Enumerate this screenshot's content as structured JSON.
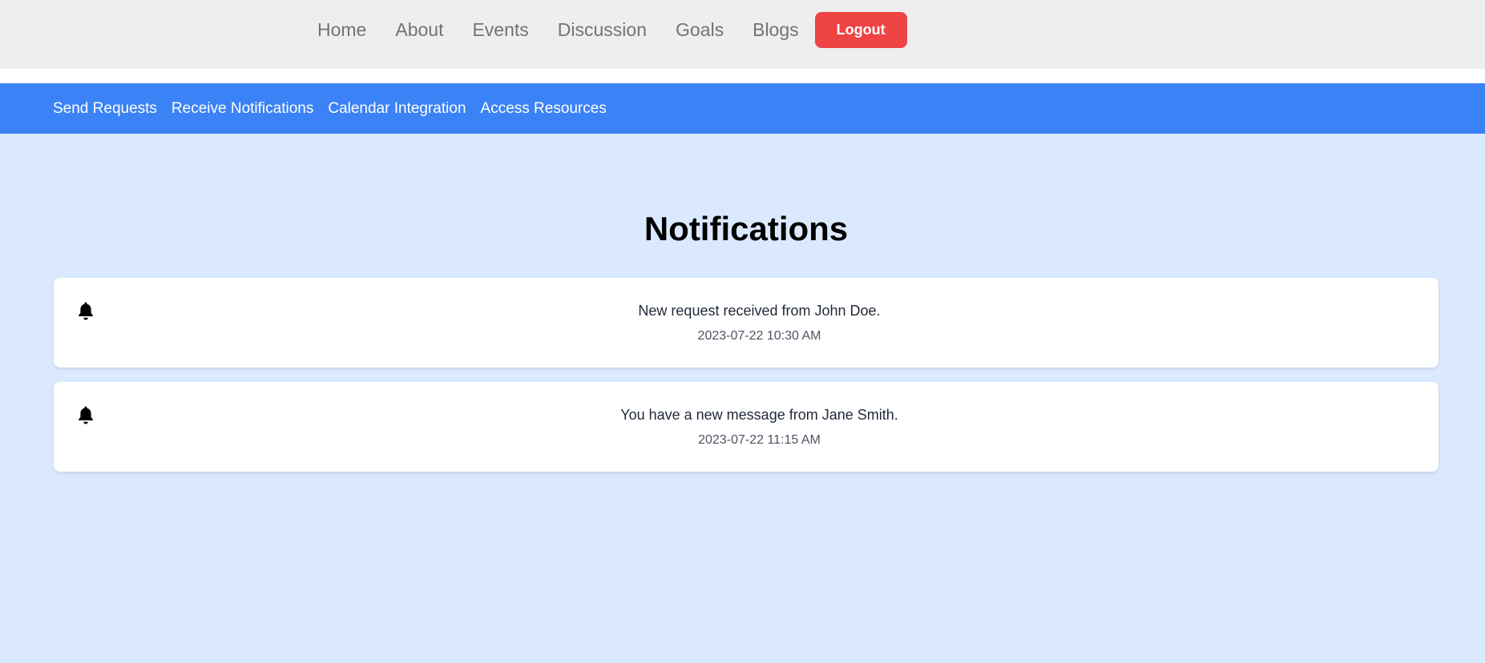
{
  "topnav": {
    "links": [
      "Home",
      "About",
      "Events",
      "Discussion",
      "Goals",
      "Blogs"
    ],
    "logout_label": "Logout"
  },
  "subnav": {
    "links": [
      "Send Requests",
      "Receive Notifications",
      "Calendar Integration",
      "Access Resources"
    ]
  },
  "main": {
    "title": "Notifications",
    "notifications": [
      {
        "message": "New request received from John Doe.",
        "time": "2023-07-22 10:30 AM",
        "icon": "bell-icon"
      },
      {
        "message": "You have a new message from Jane Smith.",
        "time": "2023-07-22 11:15 AM",
        "icon": "bell-icon"
      }
    ]
  },
  "colors": {
    "topbar_bg": "#eeeeee",
    "logout_red": "#ef4444",
    "subnav_blue": "#3b82f6",
    "page_bg": "#dbe9fe"
  }
}
